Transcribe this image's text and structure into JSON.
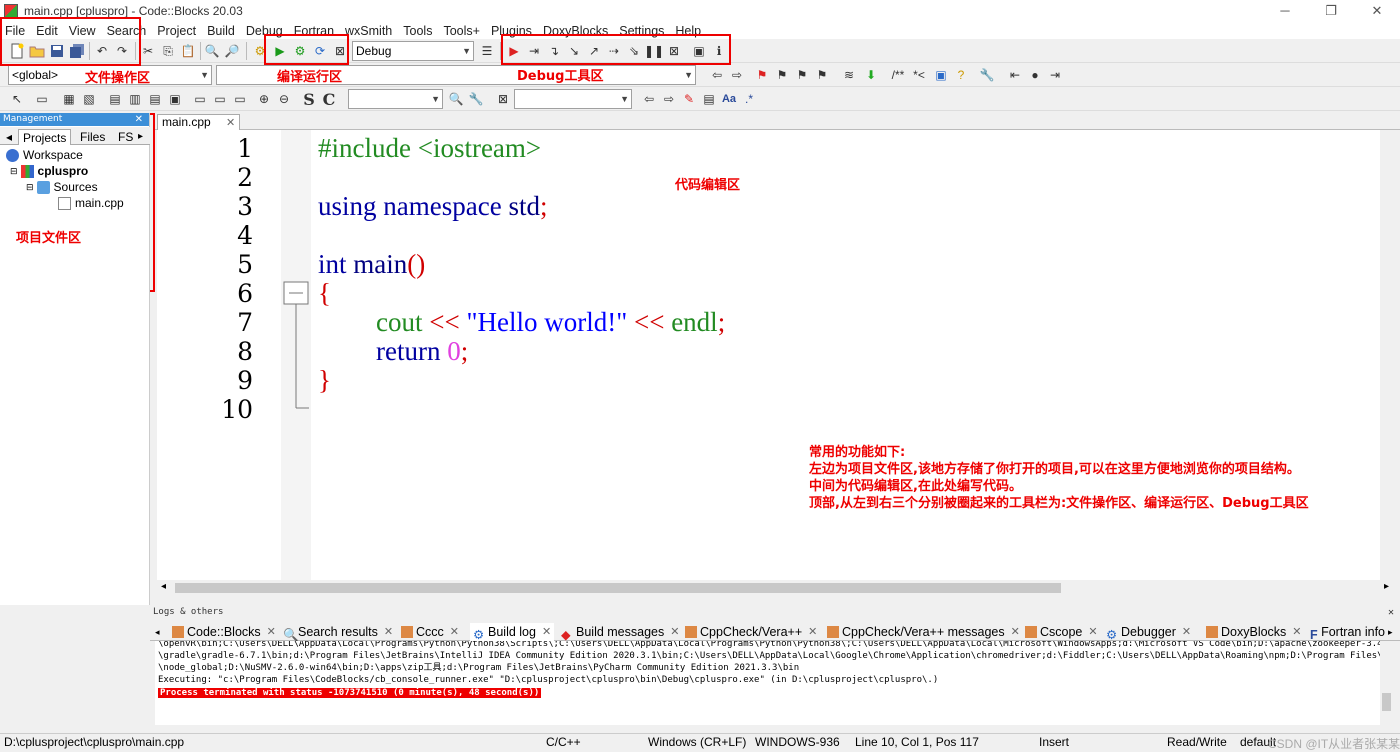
{
  "window": {
    "title": "main.cpp [cpluspro] - Code::Blocks 20.03",
    "minimize": "─",
    "maximize": "❐",
    "close": "✕"
  },
  "menu": [
    "File",
    "Edit",
    "View",
    "Search",
    "Project",
    "Build",
    "Debug",
    "Fortran",
    "wxSmith",
    "Tools",
    "Tools+",
    "Plugins",
    "DoxyBlocks",
    "Settings",
    "Help"
  ],
  "toolbar": {
    "build_target": "Debug",
    "scope_combo": "<global>",
    "comment_label": "/**",
    "uncomment_label": "*<",
    "bold_s": "S",
    "bold_c": "C",
    "aa_label": "Aa"
  },
  "annotations": {
    "file_ops": "文件操作区",
    "build_run": "编译运行区",
    "debug_tools": "Debug工具区",
    "project_files": "项目文件区",
    "code_editor": "代码编辑区",
    "note_title": "常用的功能如下:",
    "note_line1": "左边为项目文件区,该地方存储了你打开的项目,可以在这里方便地浏览你的项目结构。",
    "note_line2": "中间为代码编辑区,在此处编写代码。",
    "note_line3": "顶部,从左到右三个分别被圈起来的工具栏为:文件操作区、编译运行区、Debug工具区"
  },
  "management": {
    "header": "Management",
    "tabs": [
      "Projects",
      "Files",
      "FS"
    ],
    "tree": {
      "workspace": "Workspace",
      "project": "cpluspro",
      "folder": "Sources",
      "file": "main.cpp"
    }
  },
  "editor": {
    "tab": "main.cpp",
    "line_numbers": [
      "1",
      "2",
      "3",
      "4",
      "5",
      "6",
      "7",
      "8",
      "9",
      "10"
    ],
    "code": {
      "l1": "#include <iostream>",
      "l3_kw": "using namespace",
      "l3_id": "std",
      "l3_end": ";",
      "l5_kw": "int",
      "l5_id": "main",
      "l5_paren": "()",
      "l6": "{",
      "l7_id": "cout",
      "l7_op1": "<<",
      "l7_str": "\"Hello world!\"",
      "l7_op2": "<<",
      "l7_id2": "endl",
      "l7_end": ";",
      "l8_kw": "return",
      "l8_num": "0",
      "l8_end": ";",
      "l9": "}"
    }
  },
  "logs": {
    "header": "Logs & others",
    "tabs": [
      "Code::Blocks",
      "Search results",
      "Cccc",
      "Build log",
      "Build messages",
      "CppCheck/Vera++",
      "CppCheck/Vera++ messages",
      "Cscope",
      "Debugger",
      "DoxyBlocks",
      "Fortran info"
    ],
    "lines": [
      "\\openvR\\bin;C:\\Users\\DELL\\AppData\\Local\\Programs\\Python\\Python38\\Scripts\\;C:\\Users\\DELL\\AppData\\Local\\Programs\\Python\\Python38\\;C:\\Users\\DELL\\AppData\\Local\\Microsoft\\WindowsApps;d:\\Microsoft VS Code\\bin;D:\\apache\\zookeeper-3.4.10\\bin;D:",
      "\\gradle\\gradle-6.7.1\\bin;d:\\Program Files\\JetBrains\\IntelliJ IDEA Community Edition 2020.3.1\\bin;C:\\Users\\DELL\\AppData\\Local\\Google\\Chrome\\Application\\chromedriver;d:\\Fiddler;C:\\Users\\DELL\\AppData\\Roaming\\npm;D:\\Program Files\\nodejs",
      "\\node_global;D:\\NuSMV-2.6.0-win64\\bin;D:\\apps\\zip工具;d:\\Program Files\\JetBrains\\PyCharm Community Edition 2021.3.3\\bin",
      "Executing: \"c:\\Program Files\\CodeBlocks/cb_console_runner.exe\" \"D:\\cplusproject\\cpluspro\\bin\\Debug\\cpluspro.exe\"  (in D:\\cplusproject\\cpluspro\\.)"
    ],
    "error_line": "Process terminated with status -1073741510 (0 minute(s), 48 second(s))"
  },
  "status": {
    "path": "D:\\cplusproject\\cpluspro\\main.cpp",
    "lang": "C/C++",
    "eol": "Windows (CR+LF)",
    "encoding": "WINDOWS-936",
    "position": "Line 10, Col 1, Pos 117",
    "mode": "Insert",
    "access": "Read/Write",
    "profile": "default",
    "watermark": "CSDN @IT从业者张某某"
  },
  "colors": {
    "annotation_red": "#e00000",
    "panel_header_blue": "#3c8fd8",
    "preprocessor_green": "#228b22",
    "keyword_navy": "#0000a0",
    "string_blue": "#0000ff",
    "operator_red": "#d00000",
    "number_magenta": "#e040e0",
    "error_bg": "#e00000"
  }
}
